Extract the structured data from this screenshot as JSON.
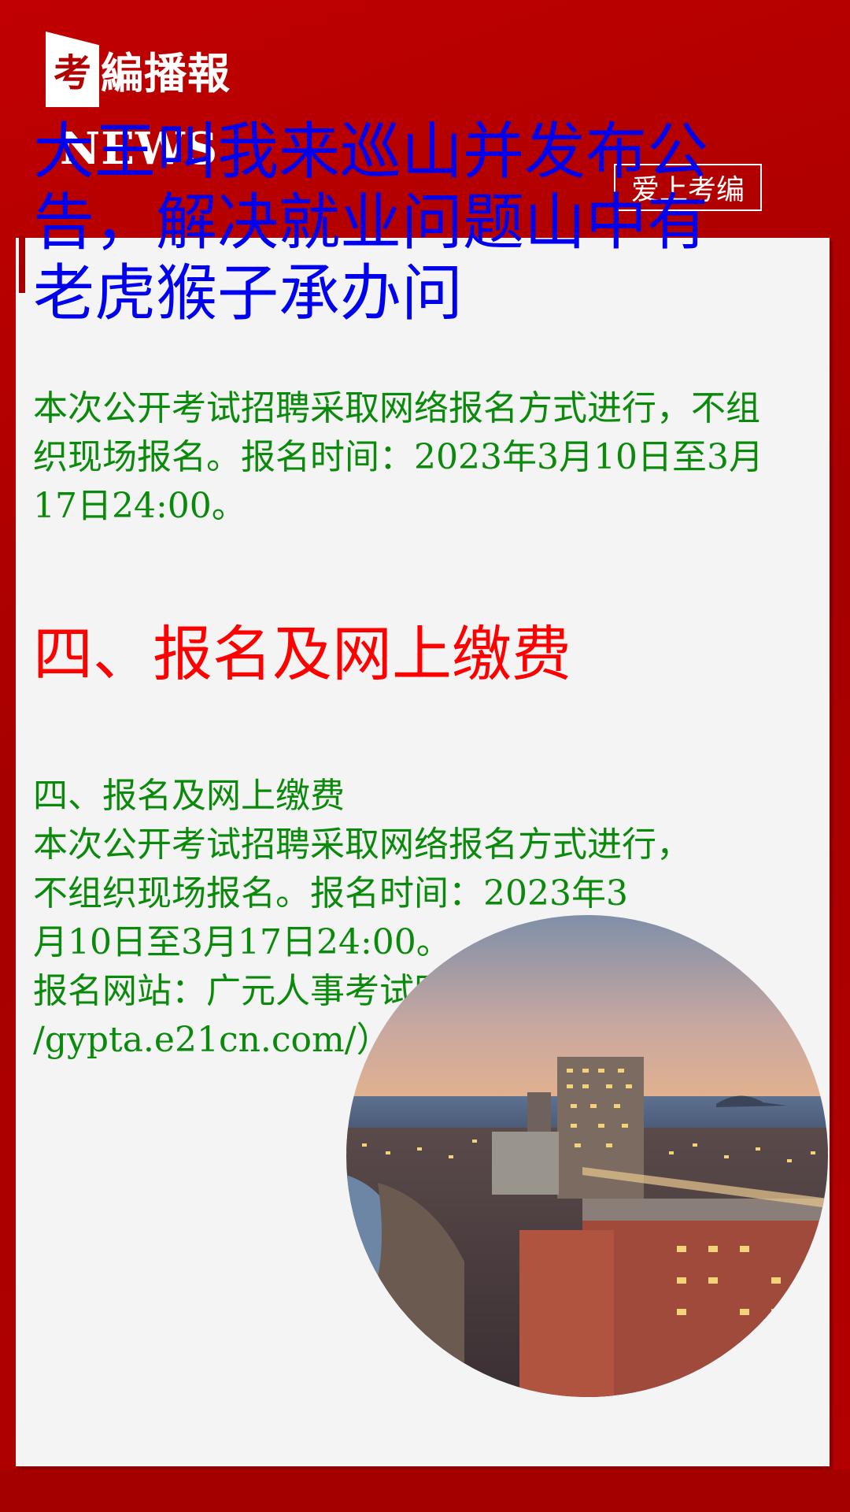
{
  "brand": {
    "logo_char": "考",
    "logo_text": "編播報",
    "news_label": "NEWS",
    "badge": "爱上考编"
  },
  "article": {
    "title": "大王叫我来巡山并发布公告，解决就业问题山中有老虎猴子承办问",
    "paragraph1": "本次公开考试招聘采取网络报名方式进行，不组织现场报名。报名时间：2023年3月10日至3月17日24:00。",
    "section_heading": "四、报名及网上缴费",
    "body_lines": [
      "四、报名及网上缴费",
      "本次公开考试招聘采取网络报名方式进行，",
      "不组织现场报名。报名时间：2023年3",
      "月10日至3月17日24:00。",
      "报名网站：广元人事考试网（http:/",
      "/gypta.e21cn.com/）。"
    ]
  },
  "colors": {
    "frame": "#a50000",
    "title": "#0000ee",
    "body": "#0a8a0a",
    "heading": "#ff0000"
  },
  "image": {
    "subject": "coastal-city-dusk-photo"
  }
}
